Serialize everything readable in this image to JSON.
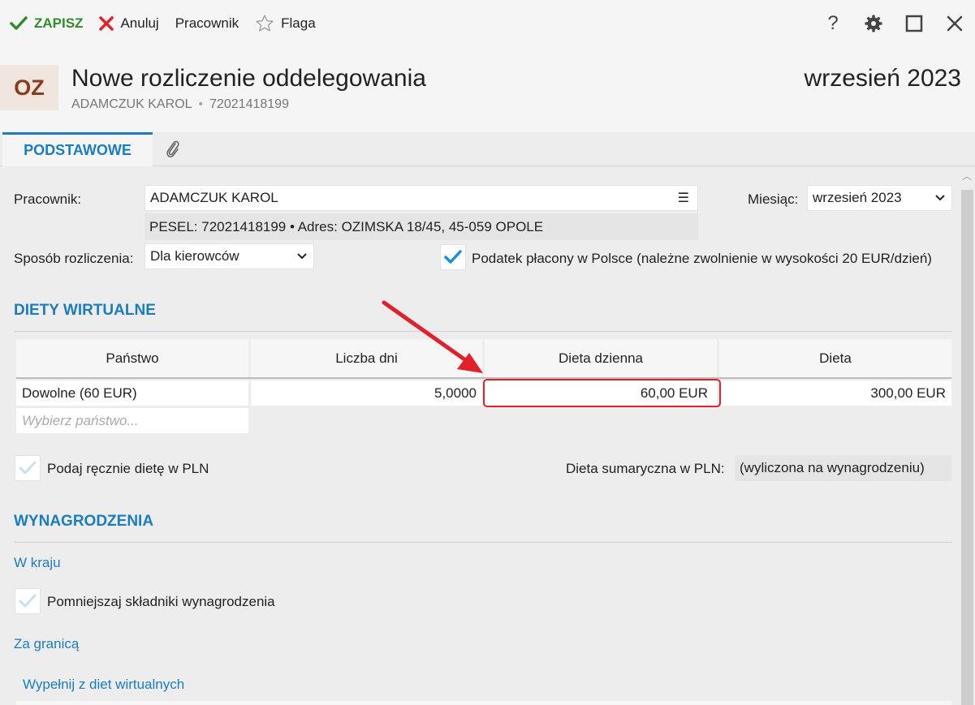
{
  "toolbar": {
    "save_label": "ZAPISZ",
    "cancel_label": "Anuluj",
    "employee_label": "Pracownik",
    "flag_label": "Flaga",
    "help_glyph": "?",
    "maximize_glyph": "☐",
    "close_glyph": "✕",
    "accent_save": "#2e8b2e",
    "accent_cancel": "#e0202a"
  },
  "header": {
    "avatar_initials": "OZ",
    "title": "Nowe rozliczenie oddelegowania",
    "employee_name": "ADAMCZUK KAROL",
    "employee_pesel": "72021418199",
    "month": "wrzesień 2023"
  },
  "tabs": [
    {
      "label": "PODSTAWOWE",
      "active": true
    },
    {
      "label": "",
      "icon": "paperclip-icon"
    }
  ],
  "form": {
    "employee_label": "Pracownik:",
    "employee_value": "ADAMCZUK KAROL",
    "employee_details": "PESEL:  72021418199  •  Adres:  OZIMSKA 18/45, 45-059 OPOLE",
    "month_label": "Miesiąc:",
    "month_value": "wrzesień 2023",
    "settlement_label": "Sposób rozliczenia:",
    "settlement_value": "Dla kierowców",
    "tax_checkbox_label": "Podatek płacony w Polsce (należne zwolnienie w wysokości 20 EUR/dzień)",
    "tax_checked": true
  },
  "diety": {
    "section_title": "DIETY WIRTUALNE",
    "columns": [
      "Państwo",
      "Liczba dni",
      "Dieta dzienna",
      "Dieta"
    ],
    "rows": [
      {
        "country": "Dowolne (60 EUR)",
        "days": "5,0000",
        "daily": "60,00 EUR",
        "total": "300,00 EUR"
      }
    ],
    "country_placeholder": "Wybierz państwo...",
    "manual_label": "Podaj ręcznie dietę w PLN",
    "manual_checked": false,
    "sum_label": "Dieta sumaryczna w PLN:",
    "sum_value": "(wyliczona na wynagrodzeniu)"
  },
  "wynagrodzenia": {
    "section_title": "WYNAGRODZENIA",
    "domestic_link": "W kraju",
    "reduce_label": "Pomniejszaj składniki wynagrodzenia",
    "reduce_checked": false,
    "abroad_link": "Za granicą",
    "fill_link": "Wypełnij z diet wirtualnych"
  },
  "colors": {
    "accent": "#1b7dbd",
    "highlight": "#e0202a",
    "avatar_bg": "#f0e4de",
    "avatar_fg": "#8b3b1b"
  }
}
